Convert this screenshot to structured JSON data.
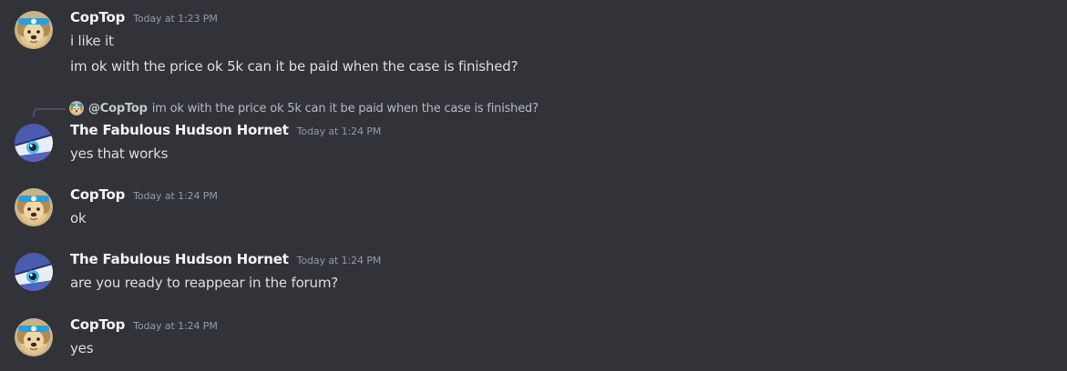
{
  "messages": [
    {
      "username": "CopTop",
      "timestamp": "Today at 1:23 PM",
      "avatar_icon": "dog-avatar-icon",
      "lines": [
        "i like it",
        "im ok with the price ok 5k can it be paid when the case is finished?"
      ]
    },
    {
      "reply": {
        "mention": "@CopTop",
        "text": "im ok with the price ok 5k can it be paid when the case is finished?",
        "avatar_icon": "dog-avatar-icon"
      },
      "username": "The Fabulous Hudson Hornet",
      "timestamp": "Today at 1:24 PM",
      "avatar_icon": "eye-avatar-icon",
      "lines": [
        "yes that works"
      ]
    },
    {
      "username": "CopTop",
      "timestamp": "Today at 1:24 PM",
      "avatar_icon": "dog-avatar-icon",
      "lines": [
        "ok"
      ]
    },
    {
      "username": "The Fabulous Hudson Hornet",
      "timestamp": "Today at 1:24 PM",
      "avatar_icon": "eye-avatar-icon",
      "lines": [
        "are you ready to reappear in the forum?"
      ]
    },
    {
      "username": "CopTop",
      "timestamp": "Today at 1:24 PM",
      "avatar_icon": "dog-avatar-icon",
      "lines": [
        "yes"
      ]
    }
  ],
  "colors": {
    "background": "#313338",
    "username": "#f2f3f5",
    "message_text": "#dbdee1",
    "timestamp": "#949ba4"
  }
}
